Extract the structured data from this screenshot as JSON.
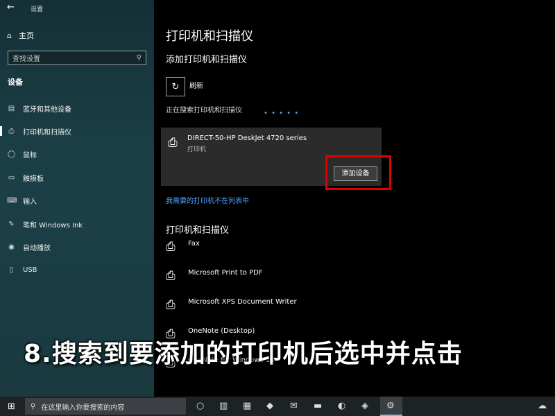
{
  "window": {
    "title": "设置"
  },
  "sidebar": {
    "home_label": "主页",
    "search_placeholder": "查找设置",
    "section": "设备",
    "items": [
      {
        "label": "蓝牙和其他设备",
        "icon": "bluetooth-devices-icon",
        "active": false
      },
      {
        "label": "打印机和扫描仪",
        "icon": "printer-icon",
        "active": true
      },
      {
        "label": "鼠标",
        "icon": "mouse-icon",
        "active": false
      },
      {
        "label": "触摸板",
        "icon": "touchpad-icon",
        "active": false
      },
      {
        "label": "输入",
        "icon": "keyboard-icon",
        "active": false
      },
      {
        "label": "笔和 Windows Ink",
        "icon": "pen-icon",
        "active": false
      },
      {
        "label": "自动播放",
        "icon": "autoplay-icon",
        "active": false
      },
      {
        "label": "USB",
        "icon": "usb-icon",
        "active": false
      }
    ]
  },
  "main": {
    "title": "打印机和扫描仪",
    "add_section_title": "添加打印机和扫描仪",
    "refresh_label": "刷新",
    "searching_text": "正在搜索打印机和扫描仪",
    "found_device": {
      "name": "DIRECT-50-HP DeskJet 4720 series",
      "type": "打印机",
      "add_button": "添加设备"
    },
    "not_listed_link": "我需要的打印机不在列表中",
    "installed_title": "打印机和扫描仪",
    "installed": [
      "Fax",
      "Microsoft Print to PDF",
      "Microsoft XPS Document Writer",
      "OneNote (Desktop)",
      "OneNote for Windows 10"
    ]
  },
  "caption": "8.搜索到要添加的打印机后选中并点击",
  "taskbar": {
    "search_placeholder": "在这里输入你要搜索的内容"
  },
  "colors": {
    "accent": "#4aa6ff",
    "highlight": "#e00000",
    "sidebar": "#1c3f47"
  }
}
